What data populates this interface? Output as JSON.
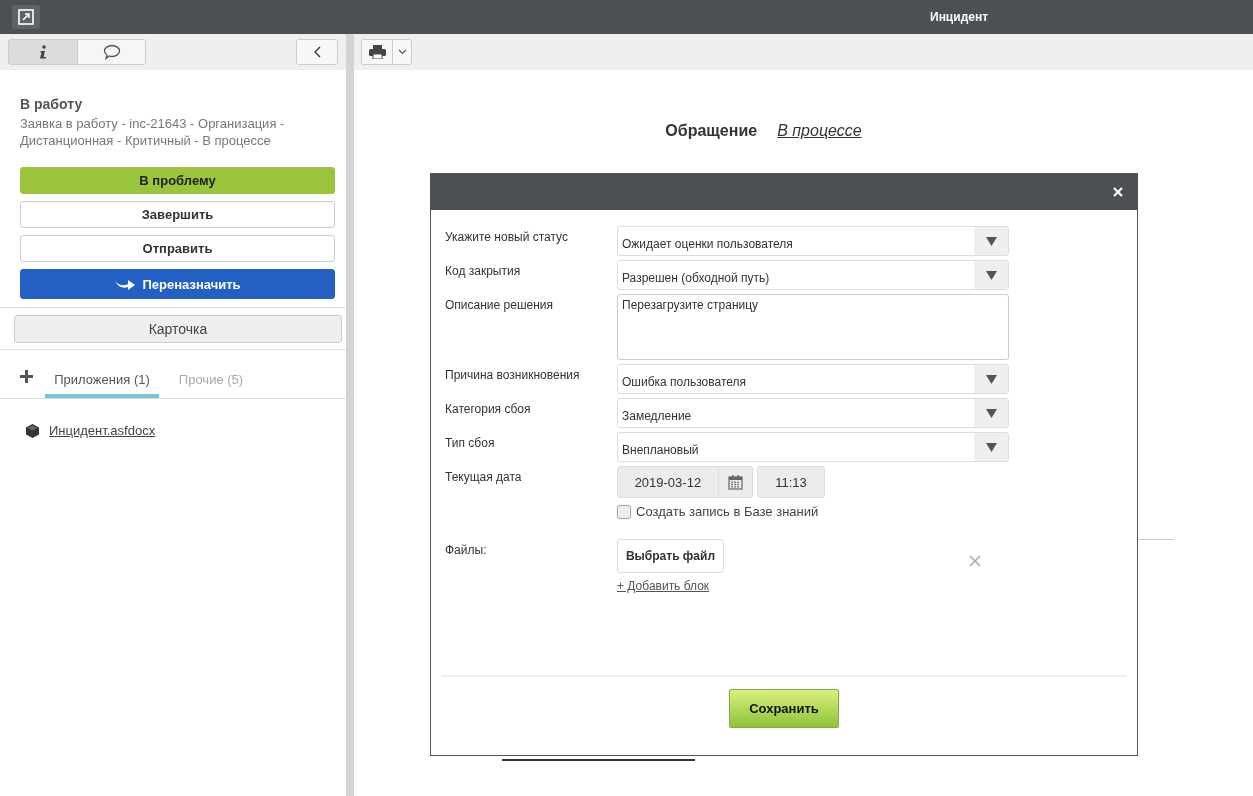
{
  "window": {
    "title": "Инцидент"
  },
  "sidebar": {
    "tabs": [
      {
        "kind": "info",
        "selected": true
      },
      {
        "kind": "comments",
        "selected": false
      }
    ],
    "heading": "В работу",
    "description": "Заявка в работу - inc-21643 - Организация - Дистанционная - Критичный - В процессе",
    "actions": [
      {
        "label": "В проблему",
        "kind": "green"
      },
      {
        "label": "Завершить",
        "kind": "plain"
      },
      {
        "label": "Отправить",
        "kind": "plain"
      },
      {
        "label": "Переназначить",
        "kind": "blue"
      }
    ],
    "card_button": "Карточка",
    "attachment_tabs": [
      {
        "label": "Приложения (1)",
        "selected": true
      },
      {
        "label": "Прочие (5)",
        "selected": false
      }
    ],
    "files": [
      {
        "name": "Инцидент.asfdocx"
      }
    ]
  },
  "document": {
    "title": "Обращение",
    "status": "В процессе"
  },
  "dialog": {
    "fields": [
      {
        "kind": "select",
        "label": "Укажите новый статус",
        "value": "Ожидает оценки пользователя"
      },
      {
        "kind": "select",
        "label": "Код закрытия",
        "value": "Разрешен (обходной путь)"
      },
      {
        "kind": "textarea",
        "label": "Описание решения",
        "value": "Перезагрузите страницу"
      },
      {
        "kind": "select",
        "label": "Причина возникновения",
        "value": "Ошибка пользователя"
      },
      {
        "kind": "select",
        "label": "Категория сбоя",
        "value": "Замедление"
      },
      {
        "kind": "select",
        "label": "Тип сбоя",
        "value": "Внеплановый"
      },
      {
        "kind": "datetime",
        "label": "Текущая дата",
        "date": "2019-03-12",
        "time": "11:13"
      }
    ],
    "knowledge_base": {
      "label": "Создать запись в Базе знаний",
      "checked": false
    },
    "files_label": "Файлы:",
    "choose_file": "Выбрать файл",
    "add_block": "+ Добавить блок",
    "save": "Сохранить"
  }
}
